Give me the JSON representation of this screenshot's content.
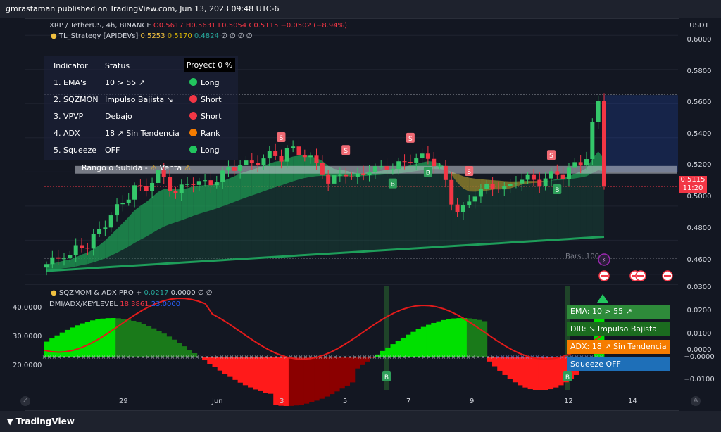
{
  "header": {
    "published_by": "gmrastaman published on TradingView.com, Jun 13, 2023 09:48 UTC-6"
  },
  "footer": {
    "brand": "TradingView"
  },
  "main_legend": {
    "symbol": "XRP / TetherUS, 4h, BINANCE",
    "o": "O0.5617",
    "h": "H0.5631",
    "l": "L0.5054",
    "c": "C0.5115",
    "change": "−0.0502 (−8.94%)",
    "strategy": "TL_Strategy [APIDEVs]",
    "v1": "0.5253",
    "v2": "0.5170",
    "v3": "0.4824",
    "tail": "∅ ∅ ∅ ∅"
  },
  "status_table": {
    "headers": [
      "Indicator",
      "Status",
      "Proyect 0 %"
    ],
    "rows": [
      {
        "indicator": "1. EMA's",
        "status": "10 > 55 ↗",
        "signal": "Long",
        "color": "#22c55e"
      },
      {
        "indicator": "2. SQZMON",
        "status": "Impulso Bajista ↘",
        "signal": "Short",
        "color": "#f23645"
      },
      {
        "indicator": "3. VPVP",
        "status": "Debajo",
        "signal": "Short",
        "color": "#f23645"
      },
      {
        "indicator": "4. ADX",
        "status": "18 ↗ Sin Tendencia",
        "signal": "Rank",
        "color": "#f57c00"
      },
      {
        "indicator": "5. Squeeze",
        "status": "OFF",
        "signal": "Long",
        "color": "#22c55e"
      }
    ],
    "range_label": "Rango o Subida -",
    "venta_label": "Venta"
  },
  "price_axis": {
    "currency": "USDT",
    "labels": [
      "0.6000",
      "0.5800",
      "0.5600",
      "0.5400",
      "0.5200",
      "0.5000",
      "0.4800",
      "0.4600"
    ],
    "current_price": "0.5115",
    "countdown": "11:20"
  },
  "bars_label": "Bars: 100",
  "osc_legend": {
    "name": "SQZMOM & ADX PRO +",
    "v1": "0.0217",
    "v2": "0.0000",
    "tail": "∅ ∅",
    "dmi": "DMI/ADX/KEYLEVEL",
    "d1": "18.3861",
    "d2": "23.0000"
  },
  "osc_left_axis": [
    "40.0000",
    "30.0000",
    "20.0000"
  ],
  "osc_right_axis": [
    "0.0300",
    "0.0200",
    "0.0100",
    "0.0000",
    "−0.0000",
    "−0.0100"
  ],
  "time_axis": [
    "29",
    "Jun",
    "3",
    "5",
    "7",
    "9",
    "12",
    "14"
  ],
  "info_box": {
    "ema": "EMA: 10 > 55 ↗",
    "dir": "DIR: ↘ Impulso Bajista",
    "adx": "ADX: 18 ↗ Sin Tendencia",
    "squeeze": "Squeeze OFF",
    "colors": {
      "ema": "#2e8b3a",
      "dir": "#1b6b1f",
      "adx": "#f57c00",
      "squeeze": "#1e6fb8"
    }
  },
  "corner_buttons": {
    "left": "Z",
    "right": "A"
  },
  "signal_letters": {
    "sell": "S",
    "buy": "B"
  },
  "chart_data": {
    "type": "candlestick",
    "y_range": [
      0.455,
      0.61
    ],
    "close_path": [
      0.466,
      0.468,
      0.472,
      0.47,
      0.478,
      0.476,
      0.483,
      0.488,
      0.495,
      0.5,
      0.505,
      0.512,
      0.508,
      0.515,
      0.52,
      0.512,
      0.508,
      0.511,
      0.515,
      0.514,
      0.512,
      0.516,
      0.52,
      0.522,
      0.525,
      0.524,
      0.526,
      0.528,
      0.531,
      0.528,
      0.534,
      0.532,
      0.53,
      0.526,
      0.522,
      0.512,
      0.518,
      0.52,
      0.515,
      0.519,
      0.522,
      0.521,
      0.524,
      0.522,
      0.525,
      0.528,
      0.527,
      0.53,
      0.525,
      0.52,
      0.504,
      0.496,
      0.5,
      0.508,
      0.51,
      0.511,
      0.512,
      0.509,
      0.515,
      0.517,
      0.515,
      0.514,
      0.517,
      0.519,
      0.518,
      0.523,
      0.525,
      0.53,
      0.561,
      0.5115
    ],
    "sell_signal_index": [
      23,
      36,
      45,
      55,
      68
    ],
    "buy_signal_index": [
      50,
      57,
      76,
      82
    ]
  }
}
